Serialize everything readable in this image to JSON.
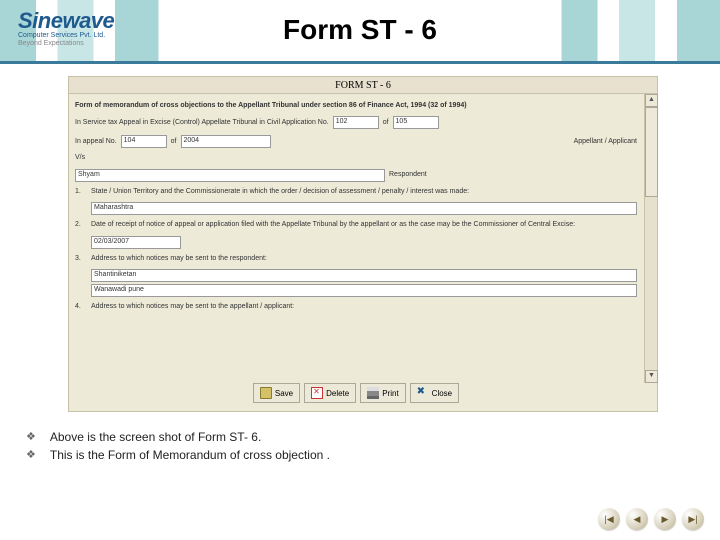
{
  "logo": {
    "brand": "Sinewave",
    "sub1": "Computer Services Pvt. Ltd.",
    "sub2": "Beyond Expectations"
  },
  "slide_title": "Form ST - 6",
  "form": {
    "titlebar": "FORM ST - 6",
    "heading": "Form of memorandum of cross objections to the Appellant Tribunal under section 86 of Finance Act, 1994 (32 of 1994)",
    "line_a_pre": "In Service tax Appeal in Excise (Control) Appellate Tribunal in Civil Application No.",
    "line_a_val1": "102",
    "line_a_mid": "of",
    "line_a_val2": "105",
    "line_b_pre": "In appeal No.",
    "line_b_val1": "104",
    "line_b_mid": "of",
    "line_b_val2": "2004",
    "line_b_role": "Appellant / Applicant",
    "vs": "V/s",
    "respondent_val": "Shyam",
    "respondent_role": "Respondent",
    "q1_num": "1.",
    "q1_text": "State / Union Territory and the Commissionerate in which the order / decision of assessment / penalty / interest was made:",
    "q1_val": "Maharashtra",
    "q2_num": "2.",
    "q2_text": "Date of receipt of notice of appeal or application filed with the Appellate Tribunal by the appellant or as the case may be the Commissioner of Central Excise:",
    "q2_val": "02/03/2007",
    "q3_num": "3.",
    "q3_text": "Address to which notices may be sent to the respondent:",
    "q3_val1": "Shantiniketan",
    "q3_val2": "Wanawadi pune",
    "q4_num": "4.",
    "q4_text": "Address to which notices may be sent to the appellant / applicant:",
    "btn_save": "Save",
    "btn_delete": "Delete",
    "btn_print": "Print",
    "btn_close": "Close"
  },
  "bullets": {
    "b1": "Above is the screen shot of Form ST- 6.",
    "b2": "This is the Form of Memorandum of cross objection ."
  },
  "nav": {
    "first": "|◀",
    "prev": "◀",
    "next": "▶",
    "last": "▶|"
  }
}
